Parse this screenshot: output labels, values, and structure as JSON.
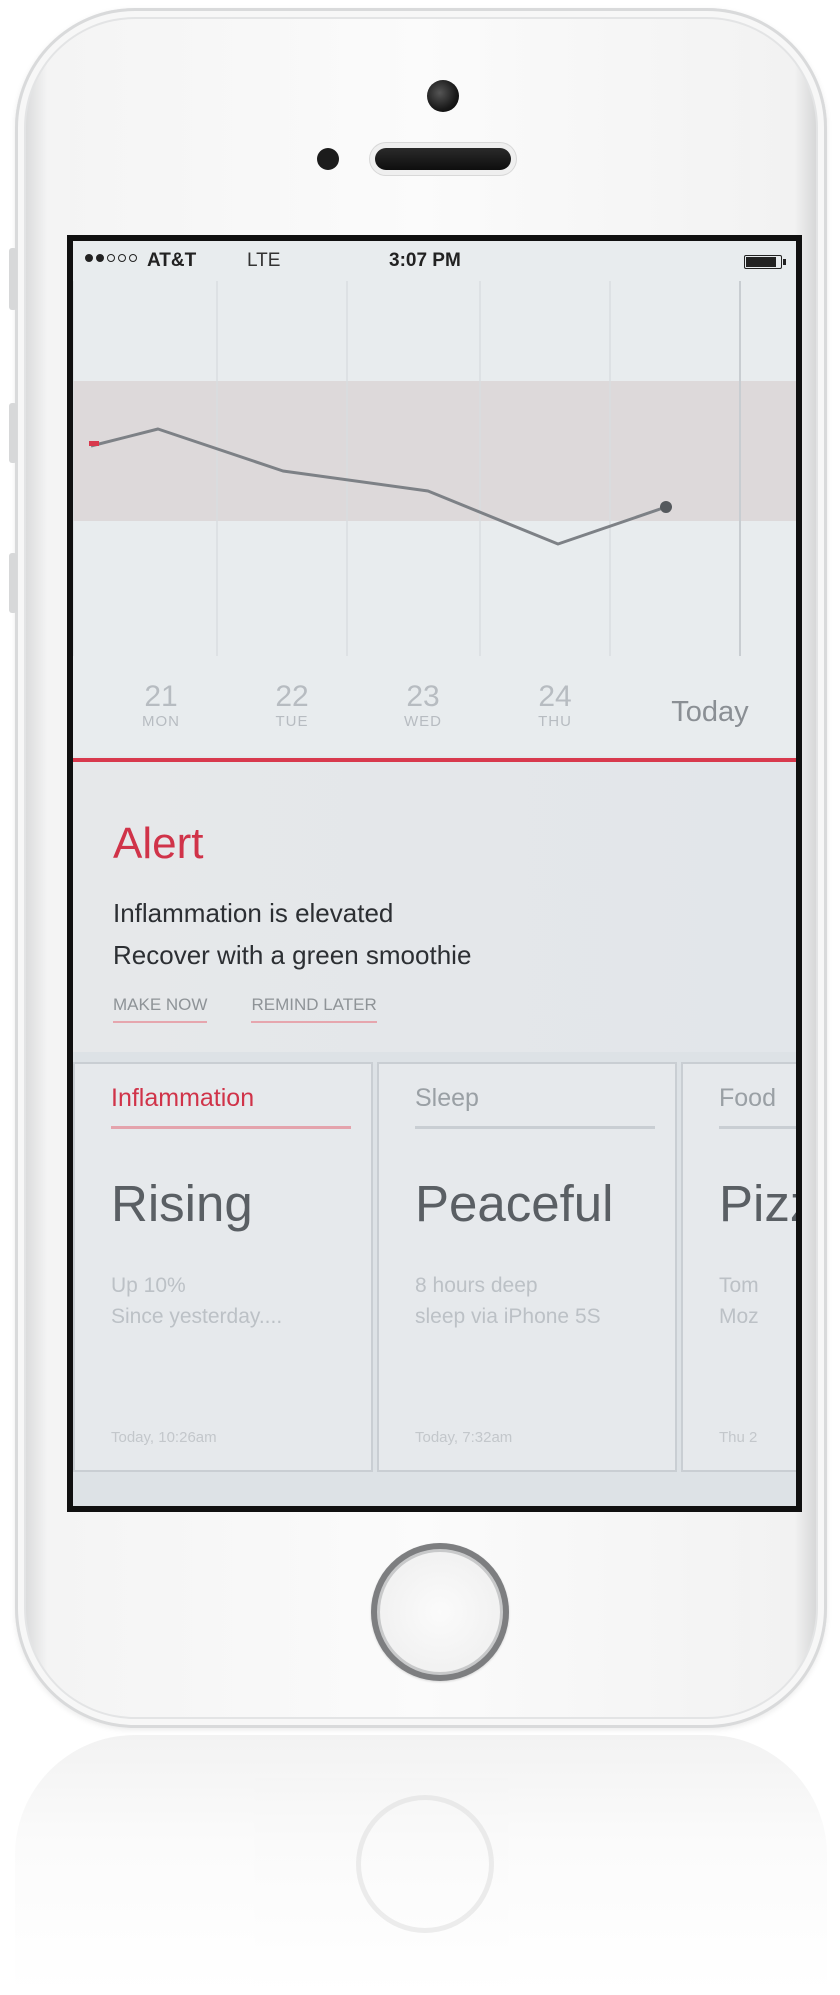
{
  "status_bar": {
    "carrier": "AT&T",
    "network": "LTE",
    "time": "3:07 PM"
  },
  "chart_data": {
    "type": "line",
    "categories": [
      "21",
      "22",
      "23",
      "24",
      "Today"
    ],
    "day_of_week": [
      "MON",
      "TUE",
      "WED",
      "THU",
      ""
    ],
    "line_color": "#7d8186",
    "end_marker_color": "#d8394d",
    "band_color": "#d9d4d5",
    "grid": true
  },
  "alert": {
    "title": "Alert",
    "line1": "Inflammation is elevated",
    "line2": "Recover with a green smoothie",
    "actions": [
      "MAKE NOW",
      "REMIND LATER"
    ]
  },
  "cards": [
    {
      "category": "Inflammation",
      "headline": "Rising",
      "detail": "Up 10%\nSince yesterday....",
      "time": "Today, 10:26am",
      "accent": "#d03349"
    },
    {
      "category": "Sleep",
      "headline": "Peaceful",
      "detail": "8 hours deep\nsleep via iPhone 5S",
      "time": "Today, 7:32am",
      "accent": ""
    },
    {
      "category": "Food",
      "headline": "Pizza",
      "detail": "Tom\nMoz",
      "time": "Thu 2",
      "accent": ""
    }
  ]
}
